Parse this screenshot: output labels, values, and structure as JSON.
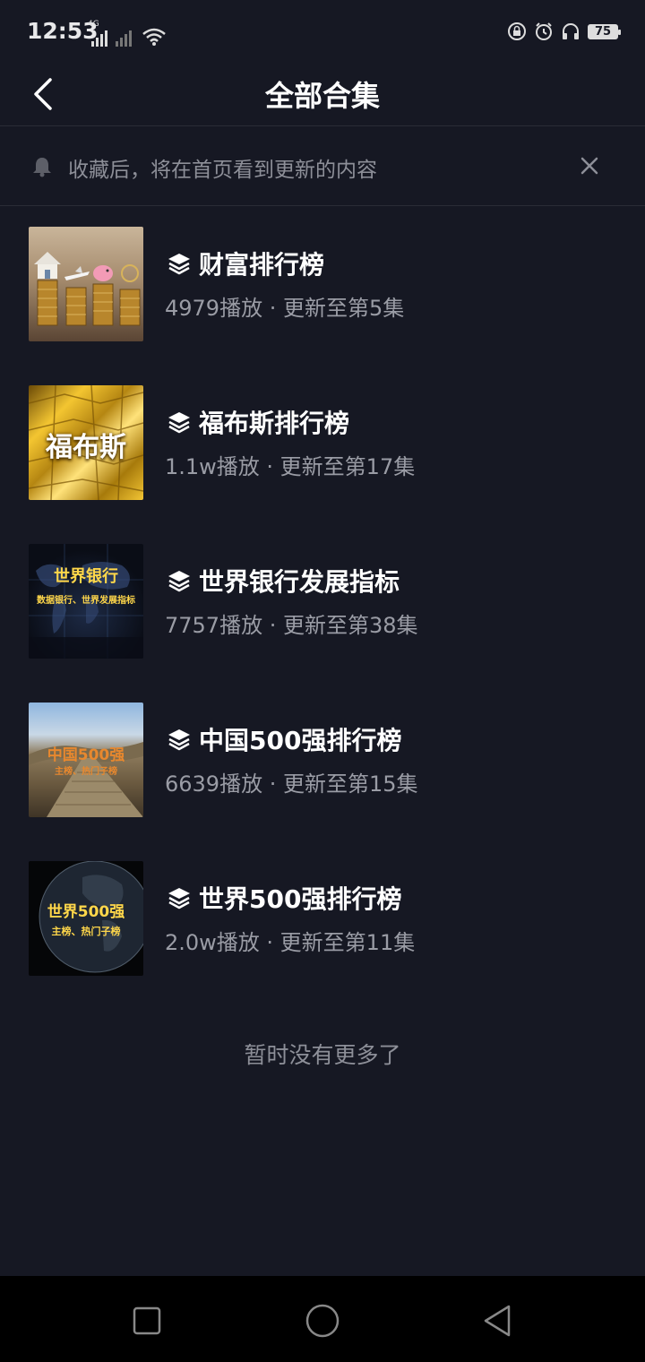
{
  "status": {
    "time": "12:53",
    "network": "4G",
    "battery": "75"
  },
  "header": {
    "title": "全部合集"
  },
  "notice": {
    "text": "收藏后，将在首页看到更新的内容"
  },
  "collections": [
    {
      "title": "财富排行榜",
      "meta": "4979播放 · 更新至第5集",
      "thumb_text": "",
      "thumb_sub": ""
    },
    {
      "title": "福布斯排行榜",
      "meta": "1.1w播放 · 更新至第17集",
      "thumb_text": "福布斯",
      "thumb_sub": ""
    },
    {
      "title": "世界银行发展指标",
      "meta": "7757播放 · 更新至第38集",
      "thumb_text": "世界银行",
      "thumb_sub": "数据银行、世界发展指标"
    },
    {
      "title": "中国500强排行榜",
      "meta": "6639播放 · 更新至第15集",
      "thumb_text": "中国500强",
      "thumb_sub": "主榜、热门子榜"
    },
    {
      "title": "世界500强排行榜",
      "meta": "2.0w播放 · 更新至第11集",
      "thumb_text": "世界500强",
      "thumb_sub": "主榜、热门子榜"
    }
  ],
  "footer": {
    "end_text": "暂时没有更多了"
  },
  "colors": {
    "background": "#161823",
    "divider": "#2a2c36",
    "secondary_text": "#9a9ca5"
  }
}
